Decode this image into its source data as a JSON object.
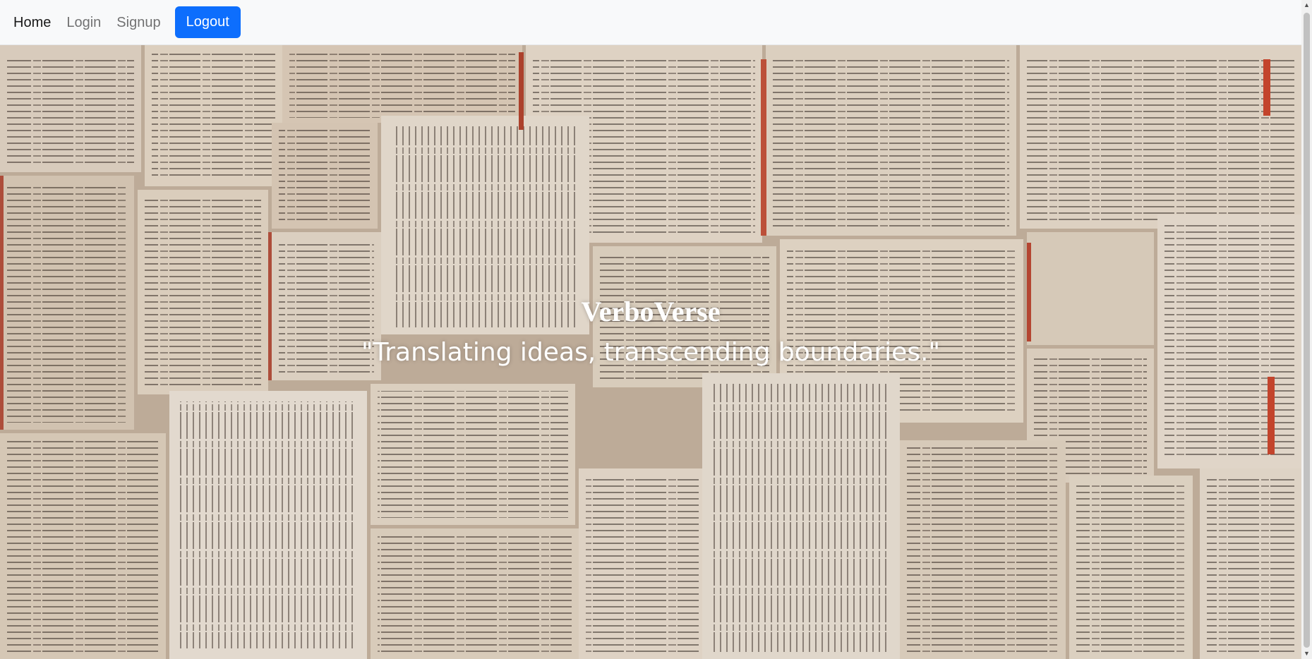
{
  "navbar": {
    "links": [
      "Home",
      "Login",
      "Signup"
    ],
    "logout_label": "Logout"
  },
  "hero": {
    "title": "VerboVerse",
    "tagline": "\"Translating ideas, transcending boundaries.\""
  },
  "colors": {
    "primary": "#0d6efd",
    "navbar_bg": "#f8f9fa",
    "hero_text": "#ffffff"
  },
  "scrollbar": {
    "up_icon": "triangle-up",
    "down_icon": "triangle-down"
  }
}
